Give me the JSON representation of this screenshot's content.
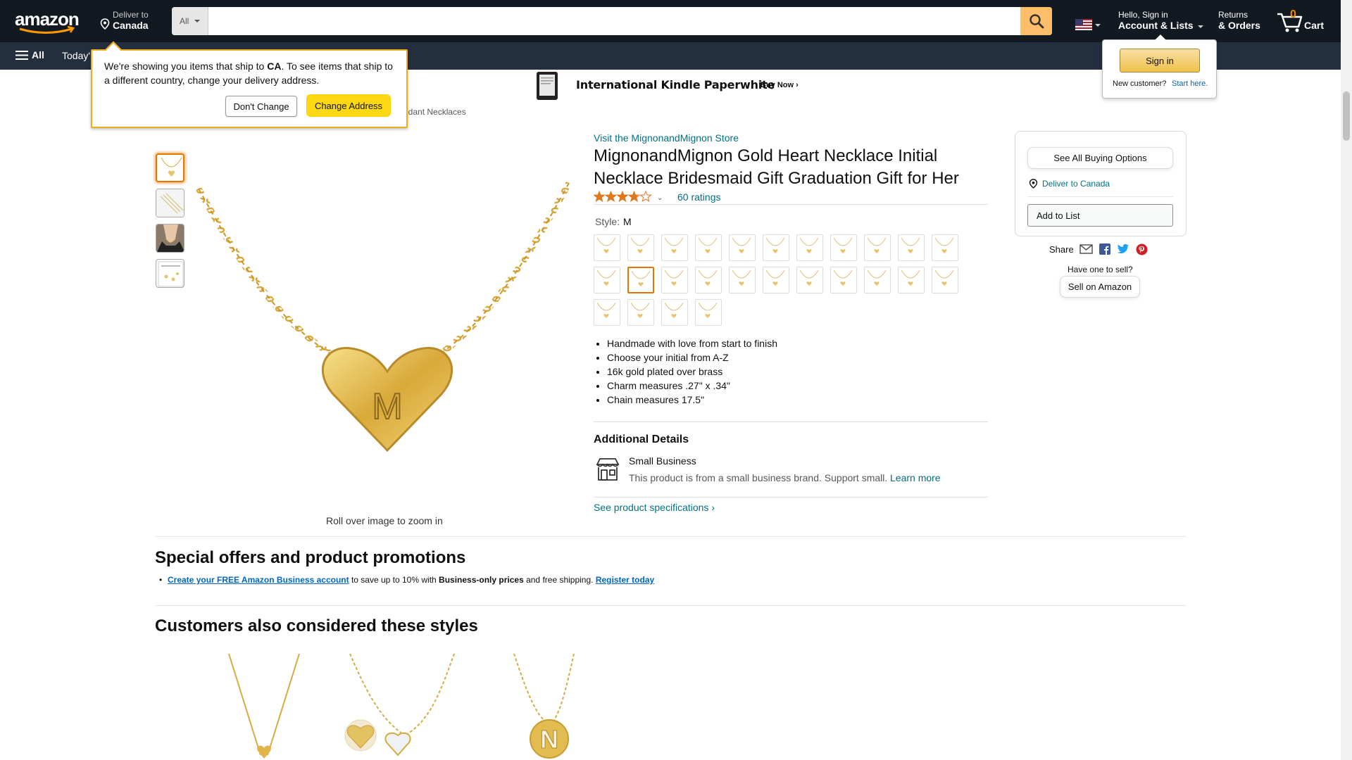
{
  "header": {
    "logo_text": "amazon",
    "deliver_small": "Deliver to",
    "deliver_big": "Canada",
    "search_category": "All",
    "search_value": "",
    "search_placeholder": "",
    "account_small": "Hello, Sign in",
    "account_big": "Account & Lists",
    "returns_small": "Returns",
    "returns_big": "& Orders",
    "cart_count": "0",
    "cart_label": "Cart"
  },
  "nav": {
    "all_label": "All",
    "today_label": "Today'"
  },
  "kindle_banner": {
    "title": "International Kindle Paperwhite",
    "buy": "Buy Now ›"
  },
  "location_popover": {
    "text_pre": "We're showing you items that ship to ",
    "country": "CA",
    "text_post": ". To see items that ship to a different country, change your delivery address.",
    "dont_change": "Don't Change",
    "change_address": "Change Address"
  },
  "account_popover": {
    "signin": "Sign in",
    "new_customer": "New customer?",
    "start_here": "Start here."
  },
  "breadcrumb": "ndant Necklaces",
  "gallery": {
    "zoom_hint": "Roll over image to zoom in",
    "main_letter": "M"
  },
  "product": {
    "store_link": "Visit the MignonandMignon Store",
    "title": "MignonandMignon Gold Heart Necklace Initial Necklace Bridesmaid Gift Graduation Gift for Her",
    "rating_value": 3.8,
    "rating_caret": "⌄",
    "rating_count": "60 ratings",
    "style_label": "Style:",
    "style_value": "M",
    "bullets": [
      "Handmade with love from start to finish",
      "Choose your initial from A-Z",
      "16k gold plated over brass",
      "Charm measures .27\" x .34\"",
      "Chain measures 17.5\""
    ],
    "additional_title": "Additional Details",
    "small_business_title": "Small Business",
    "small_business_desc": "This product is from a small business brand. Support small.",
    "learn_more": "Learn more",
    "specs_link": "See product specifications ›"
  },
  "buybox": {
    "see_options": "See All Buying Options",
    "deliver": "Deliver to Canada",
    "add_to_list": "Add to List",
    "share": "Share",
    "have_one": "Have one to sell?",
    "sell": "Sell on Amazon"
  },
  "offers": {
    "title": "Special offers and product promotions",
    "link1": "Create your FREE Amazon Business account",
    "text1": " to save up to 10% with ",
    "bold1": "Business-only prices",
    "text2": " and free shipping. ",
    "link2": "Register today"
  },
  "styles_section": {
    "title": "Customers also considered these styles"
  },
  "colors": {
    "header": "#131921",
    "nav": "#232f3e",
    "search_btn": "#febd69",
    "accent_orange": "#e77600",
    "link": "#007185",
    "star": "#de7921"
  }
}
